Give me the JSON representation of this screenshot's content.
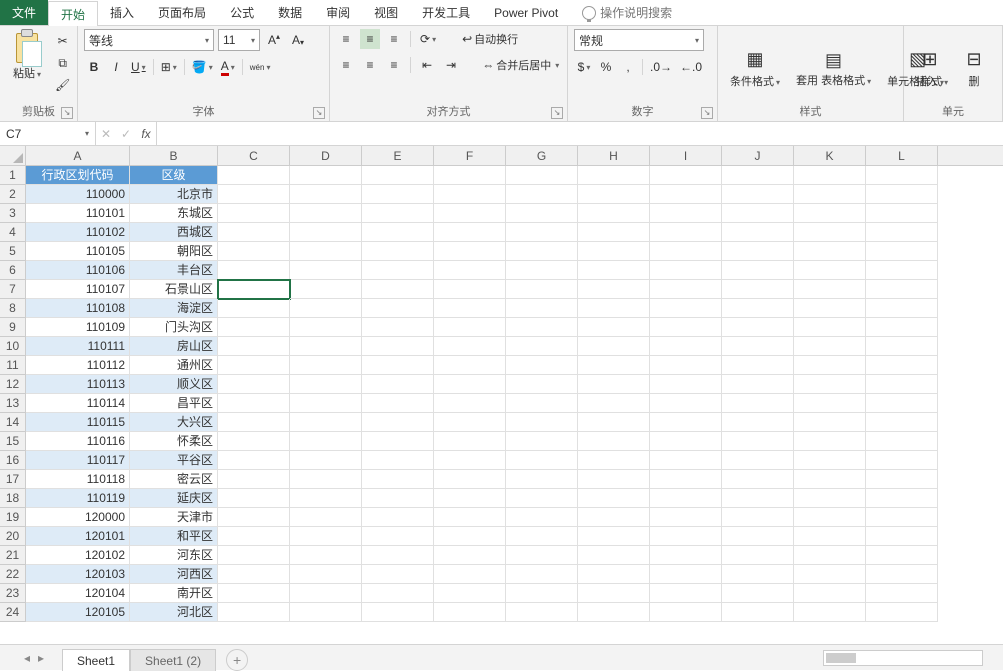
{
  "menu": {
    "file": "文件",
    "home": "开始",
    "insert": "插入",
    "layout": "页面布局",
    "formulas": "公式",
    "data": "数据",
    "review": "审阅",
    "view": "视图",
    "dev": "开发工具",
    "pivot": "Power Pivot",
    "tell": "操作说明搜索"
  },
  "ribbon": {
    "clipboard": {
      "label": "剪贴板",
      "paste": "粘贴"
    },
    "font": {
      "label": "字体",
      "name": "等线",
      "size": "11"
    },
    "align": {
      "label": "对齐方式",
      "wrap": "自动换行",
      "merge": "合并后居中"
    },
    "number": {
      "label": "数字",
      "format": "常规"
    },
    "styles": {
      "label": "样式",
      "cond": "条件格式",
      "table": "套用\n表格格式",
      "cell": "单元格样式"
    },
    "cells": {
      "label": "单元",
      "insert": "插入",
      "delete": "删"
    }
  },
  "namebox": "C7",
  "columns": [
    "A",
    "B",
    "C",
    "D",
    "E",
    "F",
    "G",
    "H",
    "I",
    "J",
    "K",
    "L"
  ],
  "col_widths": {
    "A": 104,
    "B": 88
  },
  "headers": {
    "A": "行政区划代码",
    "B": "区级"
  },
  "rows": [
    {
      "n": 2,
      "a": "110000",
      "b": "北京市"
    },
    {
      "n": 3,
      "a": "110101",
      "b": "东城区"
    },
    {
      "n": 4,
      "a": "110102",
      "b": "西城区"
    },
    {
      "n": 5,
      "a": "110105",
      "b": "朝阳区"
    },
    {
      "n": 6,
      "a": "110106",
      "b": "丰台区"
    },
    {
      "n": 7,
      "a": "110107",
      "b": "石景山区"
    },
    {
      "n": 8,
      "a": "110108",
      "b": "海淀区"
    },
    {
      "n": 9,
      "a": "110109",
      "b": "门头沟区"
    },
    {
      "n": 10,
      "a": "110111",
      "b": "房山区"
    },
    {
      "n": 11,
      "a": "110112",
      "b": "通州区"
    },
    {
      "n": 12,
      "a": "110113",
      "b": "顺义区"
    },
    {
      "n": 13,
      "a": "110114",
      "b": "昌平区"
    },
    {
      "n": 14,
      "a": "110115",
      "b": "大兴区"
    },
    {
      "n": 15,
      "a": "110116",
      "b": "怀柔区"
    },
    {
      "n": 16,
      "a": "110117",
      "b": "平谷区"
    },
    {
      "n": 17,
      "a": "110118",
      "b": "密云区"
    },
    {
      "n": 18,
      "a": "110119",
      "b": "延庆区"
    },
    {
      "n": 19,
      "a": "120000",
      "b": "天津市"
    },
    {
      "n": 20,
      "a": "120101",
      "b": "和平区"
    },
    {
      "n": 21,
      "a": "120102",
      "b": "河东区"
    },
    {
      "n": 22,
      "a": "120103",
      "b": "河西区"
    },
    {
      "n": 23,
      "a": "120104",
      "b": "南开区"
    },
    {
      "n": 24,
      "a": "120105",
      "b": "河北区"
    }
  ],
  "selected_cell": "C7",
  "sheets": {
    "s1": "Sheet1",
    "s2": "Sheet1 (2)"
  }
}
